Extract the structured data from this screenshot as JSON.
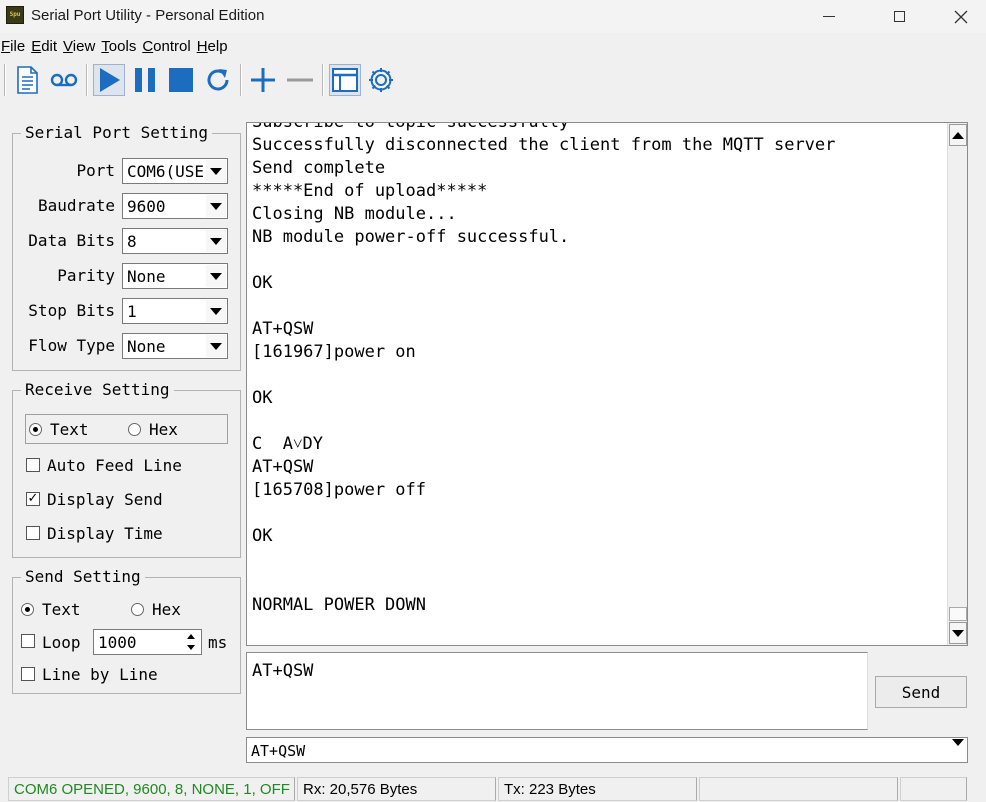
{
  "window": {
    "title": "Serial Port Utility - Personal Edition",
    "icon_text": "Spu"
  },
  "menu": [
    {
      "label": "File",
      "u": "F",
      "rest": "ile"
    },
    {
      "label": "Edit",
      "u": "E",
      "rest": "dit"
    },
    {
      "label": "View",
      "u": "V",
      "rest": "iew"
    },
    {
      "label": "Tools",
      "u": "T",
      "rest": "ools"
    },
    {
      "label": "Control",
      "u": "C",
      "rest": "ontrol"
    },
    {
      "label": "Help",
      "u": "H",
      "rest": "elp"
    }
  ],
  "toolbar": {
    "icons": [
      "document-icon",
      "record-icon",
      "play-icon",
      "pause-icon",
      "stop-icon",
      "refresh-icon",
      "add-icon",
      "remove-icon",
      "window-icon",
      "gear-icon"
    ],
    "accent": "#1c6dc0"
  },
  "serial_setting": {
    "title": "Serial Port Setting",
    "port_label": "Port",
    "port_value": "COM6(USE",
    "baud_label": "Baudrate",
    "baud_value": "9600",
    "databits_label": "Data Bits",
    "databits_value": "8",
    "parity_label": "Parity",
    "parity_value": "None",
    "stopbits_label": "Stop Bits",
    "stopbits_value": "1",
    "flow_label": "Flow Type",
    "flow_value": "None"
  },
  "receive_setting": {
    "title": "Receive Setting",
    "text_label": "Text",
    "hex_label": "Hex",
    "auto_feed_label": "Auto Feed Line",
    "display_send_label": "Display Send",
    "display_time_label": "Display Time",
    "mode": "Text",
    "auto_feed": false,
    "display_send": true,
    "display_time": false
  },
  "send_setting": {
    "title": "Send Setting",
    "text_label": "Text",
    "hex_label": "Hex",
    "loop_label": "Loop",
    "loop_value": "1000",
    "loop_unit": "ms",
    "line_by_line_label": "Line by Line",
    "mode": "Text",
    "loop": false,
    "line_by_line": false
  },
  "receive_log": [
    "Subscribe to topic successfully",
    "Successfully disconnected the client from the MQTT server",
    "Send complete",
    "*****End of upload*****",
    "Closing NB module...",
    "NB module power-off successful.",
    "",
    "OK",
    "",
    "AT+QSW",
    "[161967]power on",
    "",
    "OK",
    "",
    "C  A˅DY",
    "AT+QSW",
    "[165708]power off",
    "",
    "OK",
    "",
    "",
    "NORMAL POWER DOWN"
  ],
  "send": {
    "input_value": "AT+QSW",
    "button_label": "Send",
    "history_value": "AT+QSW"
  },
  "status": {
    "connection": "COM6 OPENED, 9600, 8, NONE, 1, OFF",
    "connection_color": "#1f8a1f",
    "rx": "Rx: 20,576 Bytes",
    "tx": "Tx: 223 Bytes"
  }
}
